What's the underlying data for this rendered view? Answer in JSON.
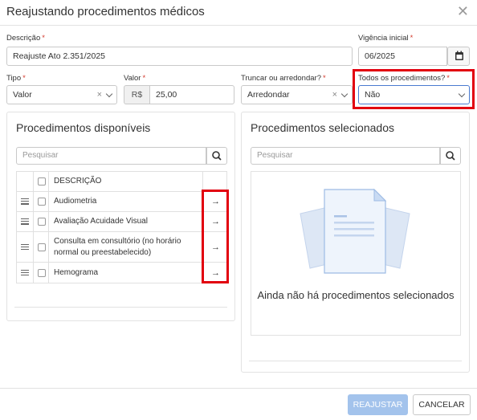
{
  "dialog": {
    "title": "Reajustando procedimentos médicos"
  },
  "form": {
    "descricao": {
      "label": "Descrição",
      "value": "Reajuste Ato 2.351/2025"
    },
    "vigencia": {
      "label": "Vigência inicial",
      "value": "06/2025"
    },
    "tipo": {
      "label": "Tipo",
      "value": "Valor"
    },
    "valor": {
      "label": "Valor",
      "prefix": "R$",
      "value": "25,00"
    },
    "truncar": {
      "label": "Truncar ou arredondar?",
      "value": "Arredondar"
    },
    "todos": {
      "label": "Todos os procedimentos?",
      "value": "Não"
    },
    "required_mark": "*"
  },
  "available": {
    "title": "Procedimentos disponíveis",
    "search_placeholder": "Pesquisar",
    "header": "DESCRIÇÃO",
    "items": [
      {
        "description": "Audiometria"
      },
      {
        "description": "Avaliação Acuidade Visual"
      },
      {
        "description": "Consulta em consultório (no horário normal ou preestabelecido)"
      },
      {
        "description": "Hemograma"
      }
    ]
  },
  "selected": {
    "title": "Procedimentos selecionados",
    "search_placeholder": "Pesquisar",
    "empty_message": "Ainda não há procedimentos selecionados"
  },
  "footer": {
    "primary_label": "REAJUSTAR",
    "cancel_label": "CANCELAR"
  },
  "icons": {
    "close": "close-icon",
    "calendar": "calendar-icon",
    "search": "search-icon",
    "drag": "drag-handle-icon",
    "arrow": "arrow-right-icon",
    "document": "document-illustration"
  },
  "colors": {
    "highlight": "#e2000f",
    "primary_disabled": "#a3c3ec",
    "required": "#d43c2f",
    "focus": "#4a7bd0"
  }
}
